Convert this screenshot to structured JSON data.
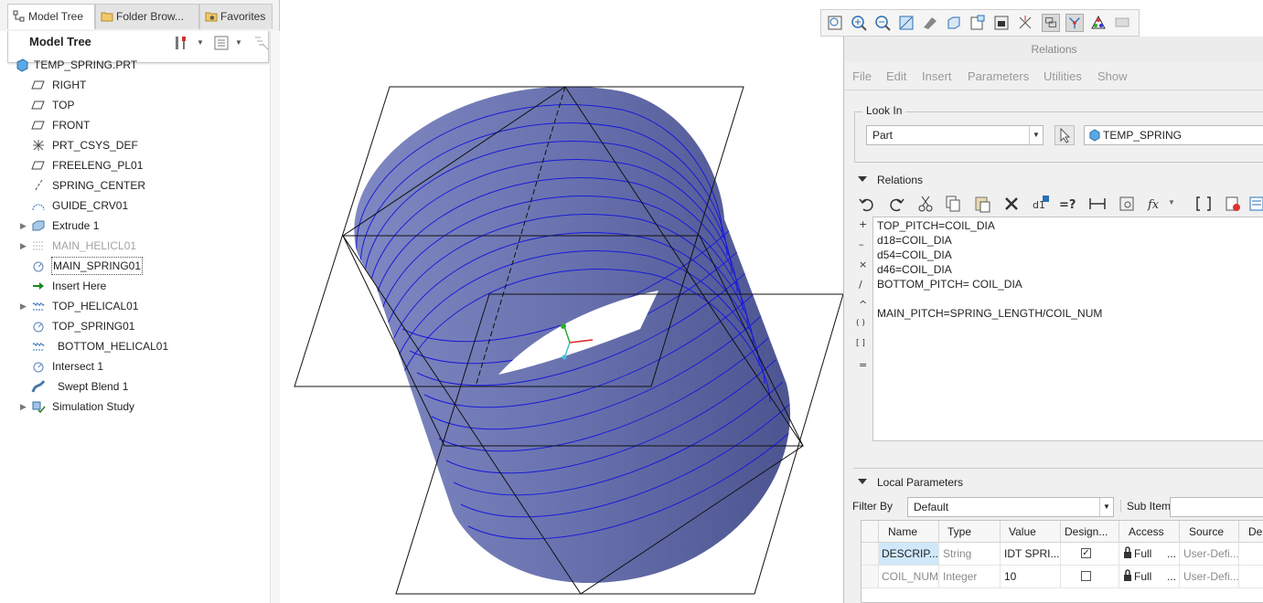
{
  "left_panel": {
    "tabs": [
      {
        "label": "Model Tree",
        "icon": "model-tree-icon"
      },
      {
        "label": "Folder Brow...",
        "icon": "folder-icon"
      },
      {
        "label": "Favorites",
        "icon": "favorites-icon"
      }
    ],
    "header_title": "Model Tree",
    "tree": [
      {
        "label": "TEMP_SPRING.PRT",
        "icon": "part-icon",
        "dim": false
      },
      {
        "label": "RIGHT",
        "icon": "datum-plane-icon",
        "dim": false
      },
      {
        "label": "TOP",
        "icon": "datum-plane-icon",
        "dim": false
      },
      {
        "label": "FRONT",
        "icon": "datum-plane-icon",
        "dim": false
      },
      {
        "label": "PRT_CSYS_DEF",
        "icon": "csys-icon",
        "dim": false
      },
      {
        "label": "FREELENG_PL01",
        "icon": "datum-plane-icon",
        "dim": false
      },
      {
        "label": "SPRING_CENTER",
        "icon": "axis-icon",
        "dim": false
      },
      {
        "label": "GUIDE_CRV01",
        "icon": "curve-icon",
        "dim": false
      },
      {
        "label": "Extrude 1",
        "icon": "extrude-icon",
        "dim": false
      },
      {
        "label": "MAIN_HELICL01",
        "icon": "helical-icon",
        "dim": true
      },
      {
        "label": "MAIN_SPRING01",
        "icon": "sweep-icon",
        "dim": false
      },
      {
        "label": "Insert Here",
        "icon": "insert-arrow-icon",
        "dim": false
      },
      {
        "label": "TOP_HELICAL01",
        "icon": "helical-icon",
        "dim": false
      },
      {
        "label": "TOP_SPRING01",
        "icon": "sweep-icon",
        "dim": false
      },
      {
        "label": "BOTTOM_HELICAL01",
        "icon": "helical-icon",
        "dim": false
      },
      {
        "label": "Intersect 1",
        "icon": "intersect-icon",
        "dim": false
      },
      {
        "label": "Swept Blend 1",
        "icon": "swept-blend-icon",
        "dim": false
      },
      {
        "label": "Simulation Study",
        "icon": "simulation-icon",
        "dim": false
      }
    ]
  },
  "relations": {
    "title": "Relations",
    "menu": [
      "File",
      "Edit",
      "Insert",
      "Parameters",
      "Utilities",
      "Show"
    ],
    "look_in_label": "Look In",
    "look_in_value": "Part",
    "model_name": "TEMP_SPRING",
    "relations_section": "Relations",
    "lines": [
      "TOP_PITCH=COIL_DIA",
      "d18=COIL_DIA",
      "d54=COIL_DIA",
      "d46=COIL_DIA",
      "BOTTOM_PITCH= COIL_DIA",
      "",
      "MAIN_PITCH=SPRING_LENGTH/COIL_NUM"
    ],
    "gutter": [
      "+",
      "–",
      "×",
      "/",
      "^",
      "( )",
      "[ ]",
      "="
    ],
    "local_params_section": "Local Parameters",
    "filter_label": "Filter By",
    "filter_value": "Default",
    "sub_items_label": "Sub Items",
    "columns": [
      "Name",
      "Type",
      "Value",
      "Design...",
      "Access",
      "Source",
      "De"
    ],
    "rows": [
      {
        "name": "DESCRIP...",
        "type": "String",
        "value": "IDT SPRI...",
        "designated": true,
        "access": "Full",
        "access_more": "...",
        "source": "User-Defi..."
      },
      {
        "name": "COIL_NUM",
        "type": "Integer",
        "value": "10",
        "designated": false,
        "access": "Full",
        "access_more": "...",
        "source": "User-Defi..."
      }
    ]
  },
  "colors": {
    "spring_fill": "#6b74b0",
    "coil_lines": "#1a1ad8",
    "selection": "#cfe8fa"
  }
}
